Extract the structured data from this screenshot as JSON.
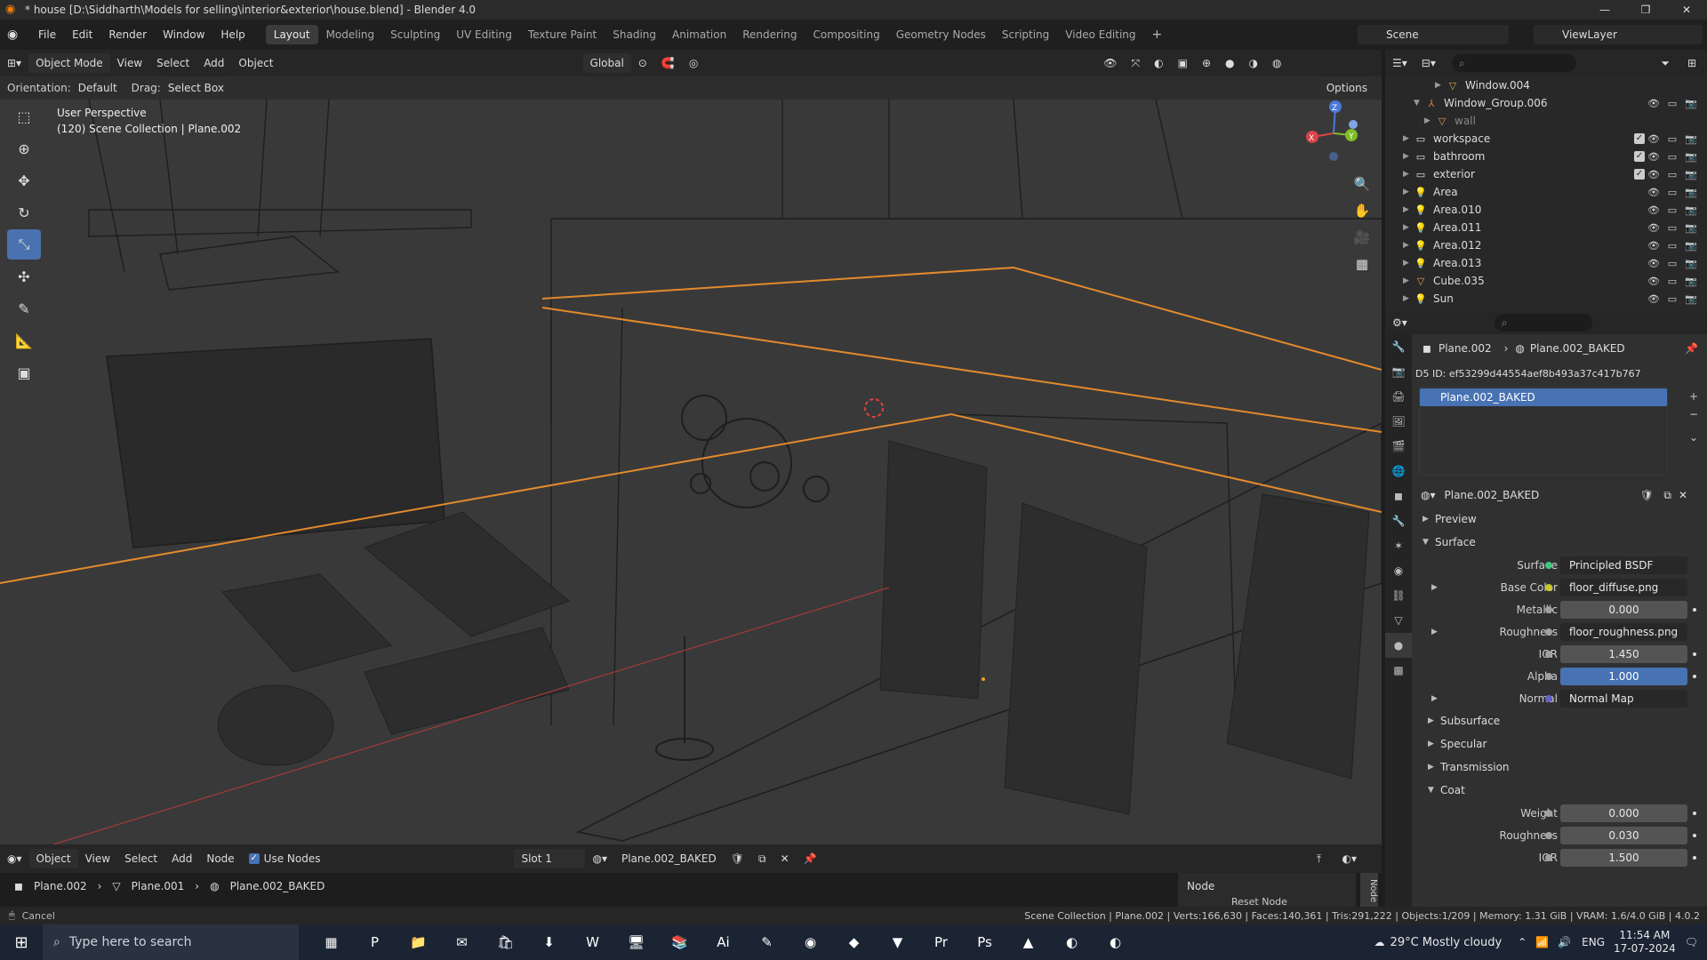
{
  "window": {
    "title": "* house [D:\\Siddharth\\Models for selling\\interior&exterior\\house.blend] - Blender 4.0",
    "controls": [
      "—",
      "❐",
      "✕"
    ]
  },
  "menubar": {
    "menus": [
      "File",
      "Edit",
      "Render",
      "Window",
      "Help"
    ],
    "workspaces": [
      "Layout",
      "Modeling",
      "Sculpting",
      "UV Editing",
      "Texture Paint",
      "Shading",
      "Animation",
      "Rendering",
      "Compositing",
      "Geometry Nodes",
      "Scripting",
      "Video Editing"
    ],
    "active_workspace": "Layout",
    "plus": "+",
    "scene": "Scene",
    "view_layer": "ViewLayer"
  },
  "viewport": {
    "mode": "Object Mode",
    "menus": [
      "View",
      "Select",
      "Add",
      "Object"
    ],
    "transform_orientation": "Global",
    "orientation_label": "Orientation:",
    "orientation_value": "Default",
    "drag_label": "Drag:",
    "drag_value": "Select Box",
    "options": "Options",
    "info_line1": "User Perspective",
    "info_line2": "(120) Scene Collection | Plane.002",
    "gizmo": {
      "x": "X",
      "y": "Y",
      "z": "Z"
    }
  },
  "outliner": {
    "rows": [
      {
        "name": "Window.004",
        "indent": 4,
        "icon": "mesh"
      },
      {
        "name": "Window_Group.006",
        "indent": 2,
        "icon": "empty",
        "flags": true
      },
      {
        "name": "wall",
        "indent": 3,
        "icon": "mesh",
        "dim": true
      },
      {
        "name": "workspace",
        "indent": 1,
        "icon": "collection",
        "check": true,
        "flags": true
      },
      {
        "name": "bathroom",
        "indent": 1,
        "icon": "collection",
        "check": true,
        "flags": true
      },
      {
        "name": "exterior",
        "indent": 1,
        "icon": "collection",
        "check": true,
        "flags": true
      },
      {
        "name": "Area",
        "indent": 1,
        "icon": "light",
        "flags": true
      },
      {
        "name": "Area.010",
        "indent": 1,
        "icon": "light",
        "flags": true
      },
      {
        "name": "Area.011",
        "indent": 1,
        "icon": "light",
        "flags": true
      },
      {
        "name": "Area.012",
        "indent": 1,
        "icon": "light",
        "flags": true
      },
      {
        "name": "Area.013",
        "indent": 1,
        "icon": "light",
        "flags": true
      },
      {
        "name": "Cube.035",
        "indent": 1,
        "icon": "mesh",
        "flags": true
      },
      {
        "name": "Sun",
        "indent": 1,
        "icon": "light",
        "flags": true
      }
    ]
  },
  "properties": {
    "breadcrumb_object": "Plane.002",
    "breadcrumb_material": "Plane.002_BAKED",
    "d5_id": "D5 ID: ef53299d44554aef8b493a37c417b767",
    "material_slot": "Plane.002_BAKED",
    "material_name": "Plane.002_BAKED",
    "preview": "Preview",
    "surface_section": "Surface",
    "rows": [
      {
        "label": "Surface",
        "value": "Principled BSDF",
        "type": "link",
        "dot": "green"
      },
      {
        "label": "Base Color",
        "value": "floor_diffuse.png",
        "type": "link",
        "dot": "yellow",
        "tri": true
      },
      {
        "label": "Metallic",
        "value": "0.000",
        "type": "num",
        "dot": "grey"
      },
      {
        "label": "Roughness",
        "value": "floor_roughness.png",
        "type": "link",
        "dot": "grey",
        "tri": true
      },
      {
        "label": "IOR",
        "value": "1.450",
        "type": "num",
        "dot": "grey"
      },
      {
        "label": "Alpha",
        "value": "1.000",
        "type": "blue",
        "dot": "grey"
      },
      {
        "label": "Normal",
        "value": "Normal Map",
        "type": "link",
        "dot": "purple",
        "tri": true
      }
    ],
    "subsections": [
      "Subsurface",
      "Specular",
      "Transmission"
    ],
    "coat_section": "Coat",
    "coat_rows": [
      {
        "label": "Weight",
        "value": "0.000"
      },
      {
        "label": "Roughness",
        "value": "0.030"
      },
      {
        "label": "IOR",
        "value": "1.500"
      }
    ]
  },
  "shader_editor": {
    "type": "Object",
    "menus": [
      "View",
      "Select",
      "Add",
      "Node"
    ],
    "use_nodes": "Use Nodes",
    "slot": "Slot 1",
    "material": "Plane.002_BAKED",
    "breadcrumb": [
      "Plane.002",
      "Plane.001",
      "Plane.002_BAKED"
    ],
    "node_panel_title": "Node",
    "node_panel_button": "Reset Node",
    "side_tab": "Node"
  },
  "statusbar": {
    "left": "Cancel",
    "right": "Scene Collection | Plane.002 | Verts:166,630 | Faces:140,361 | Tris:291,222 | Objects:1/209 | Memory: 1.31 GiB | VRAM: 1.6/4.0 GiB | 4.0.2"
  },
  "taskbar": {
    "search_placeholder": "Type here to search",
    "apps": [
      "▦",
      "P",
      "📁",
      "✉",
      "🛍",
      "⬇",
      "W",
      "🖥",
      "📚",
      "Ai",
      "✎",
      "◉",
      "◆",
      "▼",
      "Pr",
      "Ps",
      "▲",
      "◐",
      "◐"
    ],
    "weather": "29°C  Mostly cloudy",
    "language": "ENG",
    "time": "11:54 AM",
    "date": "17-07-2024"
  }
}
